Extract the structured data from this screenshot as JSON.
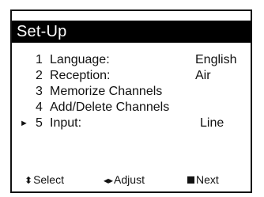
{
  "title": "Set-Up",
  "menu": {
    "items": [
      {
        "number": "1",
        "label": "Language:",
        "value": "English"
      },
      {
        "number": "2",
        "label": "Reception:",
        "value": "Air"
      },
      {
        "number": "3",
        "label": "Memorize Channels",
        "value": ""
      },
      {
        "number": "4",
        "label": "Add/Delete Channels",
        "value": ""
      },
      {
        "number": "5",
        "label": "Input:",
        "value": "Line"
      }
    ],
    "selected_index": 4,
    "pointer_glyph": "►"
  },
  "footer": {
    "select": {
      "glyph": "⬍",
      "label": "Select",
      "icon": "up-down-arrow-icon"
    },
    "adjust": {
      "glyph": "◂▸",
      "label": "Adjust",
      "icon": "left-right-arrow-icon"
    },
    "next": {
      "label": "Next",
      "icon": "square-icon"
    }
  },
  "colors": {
    "title_background": "#000000",
    "title_text": "#ffffff",
    "text": "#111111",
    "background": "#ffffff"
  }
}
